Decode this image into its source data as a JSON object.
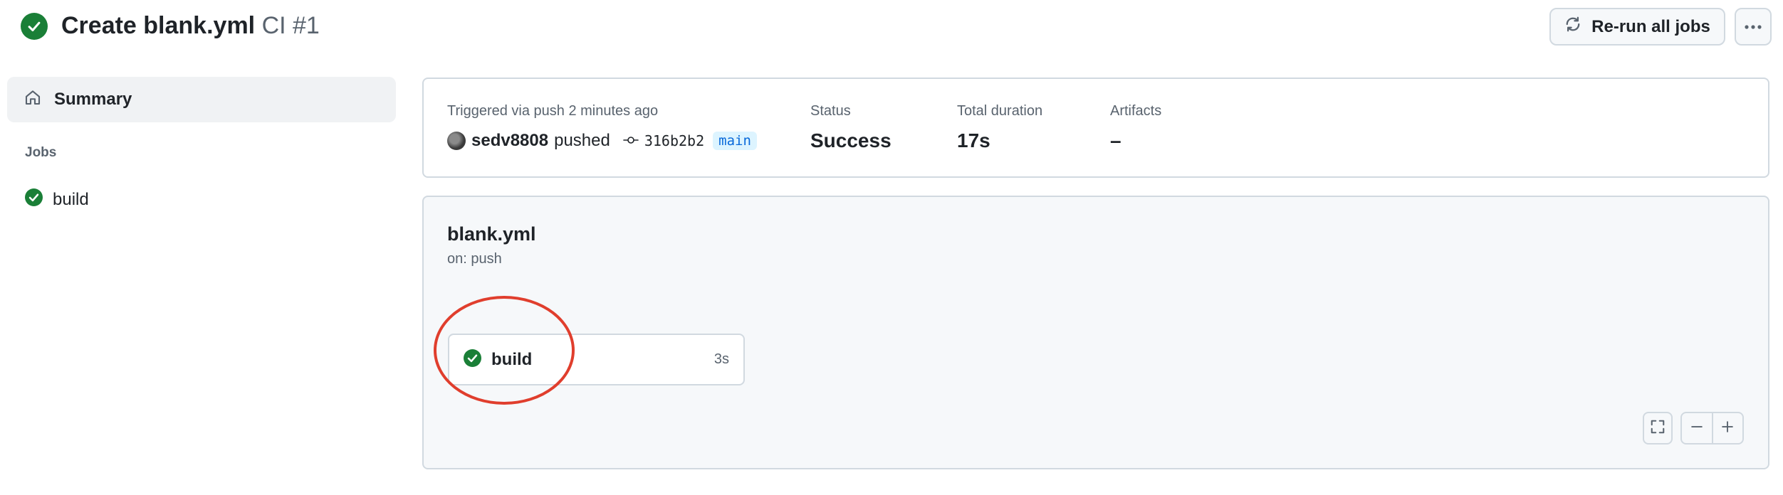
{
  "header": {
    "title": "Create blank.yml",
    "workflow_run": "CI #1",
    "rerun_label": "Re-run all jobs"
  },
  "sidebar": {
    "summary_label": "Summary",
    "jobs_heading": "Jobs",
    "jobs": [
      {
        "label": "build",
        "status": "success"
      }
    ]
  },
  "summary": {
    "trigger_label": "Triggered via push 2 minutes ago",
    "user": "sedv8808",
    "action": "pushed",
    "commit": "316b2b2",
    "branch": "main",
    "status_label": "Status",
    "status_value": "Success",
    "duration_label": "Total duration",
    "duration_value": "17s",
    "artifacts_label": "Artifacts",
    "artifacts_value": "–"
  },
  "graph": {
    "workflow_file": "blank.yml",
    "trigger": "on: push",
    "job": {
      "name": "build",
      "duration": "3s",
      "status": "success"
    }
  },
  "colors": {
    "success": "#1a7f37",
    "accent_link": "#0969da",
    "highlight": "#e03e2d"
  },
  "icons": [
    "check-circle-icon",
    "sync-icon",
    "kebab-horizontal-icon",
    "home-icon",
    "git-commit-icon",
    "fullscreen-icon",
    "zoom-out-icon",
    "zoom-in-icon"
  ]
}
